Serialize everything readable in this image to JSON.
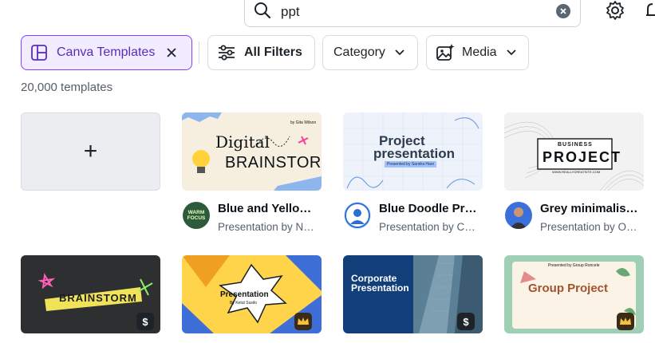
{
  "search": {
    "value": "ppt"
  },
  "filters": {
    "active_chip": "Canva Templates",
    "all_filters": "All Filters",
    "category": "Category",
    "media": "Media"
  },
  "results_count": "20,000 templates",
  "templates_row1": [
    {
      "title": "Blue and Yello…",
      "subtitle": "Presentation by N…",
      "thumb_title_line1": "Digital",
      "thumb_title_line2": "BRAINSTORM",
      "thumb_corner": "by Gita Wilson"
    },
    {
      "title": "Blue Doodle Pr…",
      "subtitle": "Presentation by C…",
      "thumb_title_line1": "Project",
      "thumb_title_line2": "presentation",
      "thumb_tag": "Presented by Sandra Haro"
    },
    {
      "title": "Grey minimalis…",
      "subtitle": "Presentation by O…",
      "thumb_title_line1": "BUSINESS",
      "thumb_title_line2": "PROJECT",
      "thumb_url": "WWW.REALLYGREATSITE.COM"
    }
  ],
  "templates_row2": [
    {
      "thumb_title": "BRAINSTORM",
      "badge": "$"
    },
    {
      "thumb_title": "Presentation",
      "thumb_subtitle": "By Ketut Susilo"
    },
    {
      "thumb_title_line1": "Corporate",
      "thumb_title_line2": "Presentation",
      "badge": "$"
    },
    {
      "thumb_title": "Group Project",
      "thumb_subtitle": "Presented by Group Roncele"
    }
  ],
  "avatar_labels": {
    "first": "WARM FOCUS"
  },
  "colors": {
    "accent": "#8b3dff",
    "chip_active_bg": "#f1ecff",
    "chip_active_text": "#5b2bbf"
  }
}
